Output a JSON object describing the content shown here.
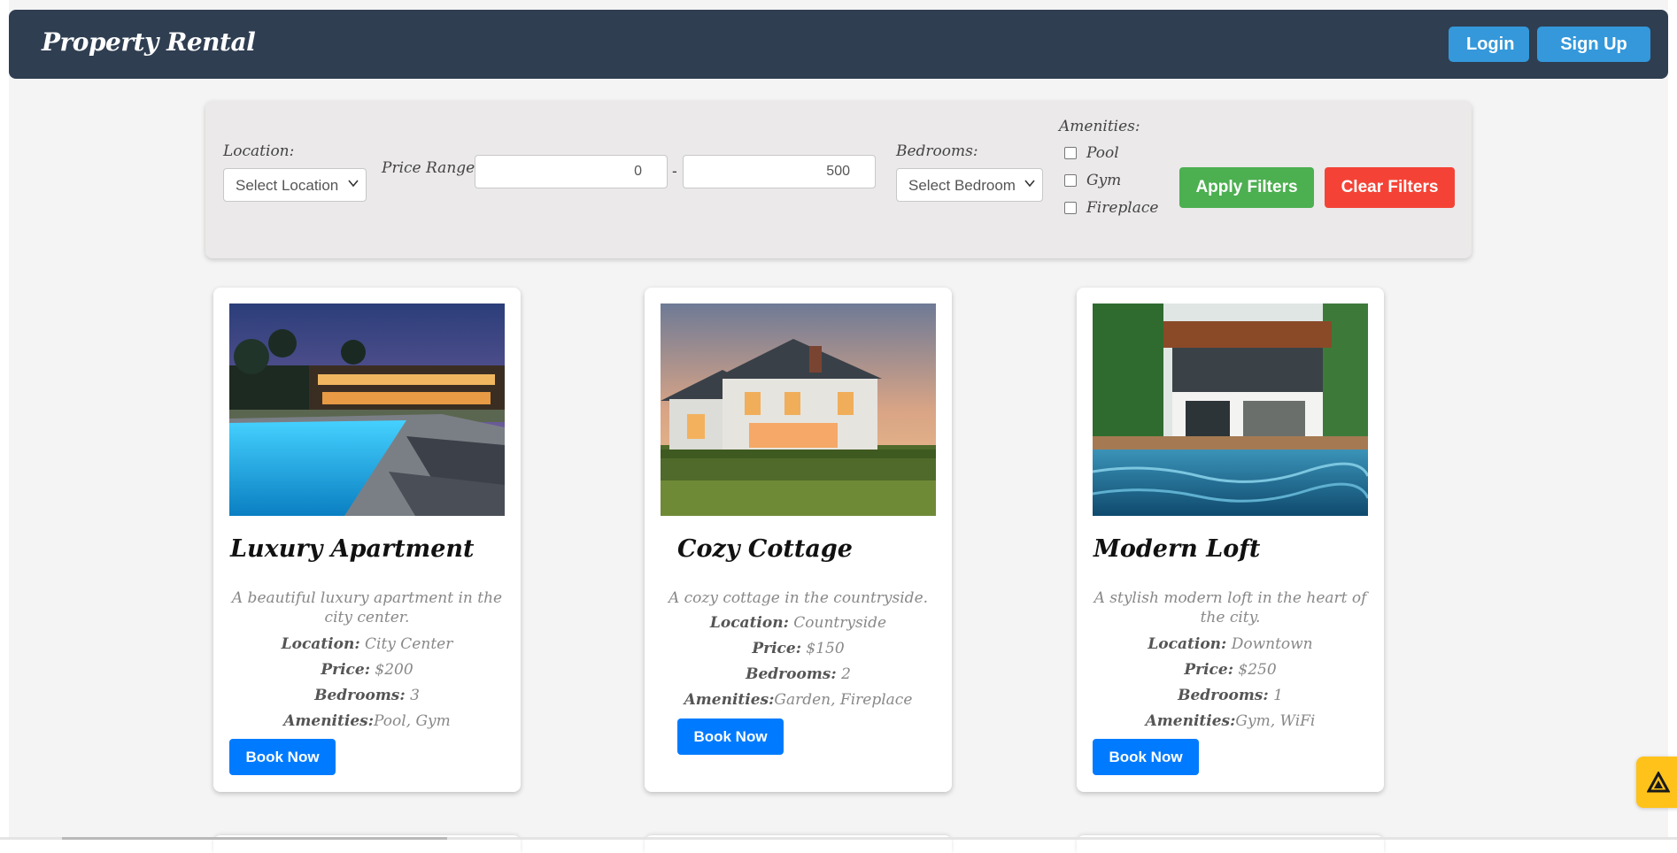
{
  "nav": {
    "brand": "Property Rental",
    "login_label": "Login",
    "signup_label": "Sign Up"
  },
  "filters": {
    "location_label": "Location:",
    "location_value": "Select Location",
    "price_label": "Price Range:",
    "price_min": "0",
    "price_max": "500",
    "price_sep": "-",
    "bedrooms_label": "Bedrooms:",
    "bedrooms_value": "Select Bedroom",
    "amenities_label": "Amenities:",
    "amenities": [
      "Pool",
      "Gym",
      "Fireplace"
    ],
    "apply_label": "Apply Filters",
    "clear_label": "Clear Filters"
  },
  "properties": [
    {
      "title": "Luxury Apartment",
      "description": "A beautiful luxury apartment in the city center.",
      "location_key": "Location:",
      "location": "City Center",
      "price_key": "Price:",
      "price": "$200",
      "bedrooms_key": "Bedrooms:",
      "bedrooms": "3",
      "amenities_key": "Amenities:",
      "amenities": "Pool, Gym",
      "book_label": "Book Now"
    },
    {
      "title": "Cozy Cottage",
      "description": "A cozy cottage in the countryside.",
      "location_key": "Location:",
      "location": "Countryside",
      "price_key": "Price:",
      "price": "$150",
      "bedrooms_key": "Bedrooms:",
      "bedrooms": "2",
      "amenities_key": "Amenities:",
      "amenities": "Garden, Fireplace",
      "book_label": "Book Now"
    },
    {
      "title": "Modern Loft",
      "description": "A stylish modern loft in the heart of the city.",
      "location_key": "Location:",
      "location": "Downtown",
      "price_key": "Price:",
      "price": "$250",
      "bedrooms_key": "Bedrooms:",
      "bedrooms": "1",
      "amenities_key": "Amenities:",
      "amenities": "Gym, WiFi",
      "book_label": "Book Now"
    }
  ],
  "colors": {
    "navbar": "#2f3e51",
    "nav_button": "#3498db",
    "apply": "#4caf50",
    "clear": "#f44336",
    "book": "#007bff",
    "help_widget": "#ffc21a"
  },
  "icons": {
    "dropdown": "chevron-down-icon",
    "help_widget": "triangle-logo-icon"
  }
}
